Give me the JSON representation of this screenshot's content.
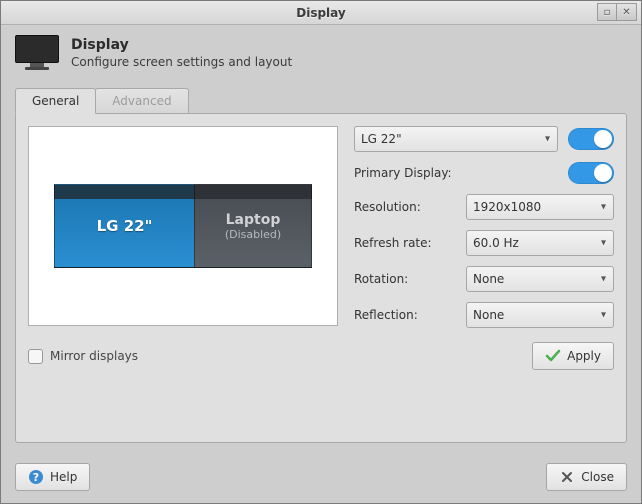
{
  "window": {
    "title": "Display"
  },
  "header": {
    "title": "Display",
    "subtitle": "Configure screen settings and layout"
  },
  "tabs": {
    "general": "General",
    "advanced": "Advanced"
  },
  "preview": {
    "primary": {
      "name": "LG 22\""
    },
    "secondary": {
      "name": "Laptop",
      "status": "(Disabled)"
    }
  },
  "settings": {
    "display_selected": "LG 22\"",
    "primary_label": "Primary Display:",
    "resolution_label": "Resolution:",
    "resolution_value": "1920x1080",
    "refresh_label": "Refresh rate:",
    "refresh_value": "60.0 Hz",
    "rotation_label": "Rotation:",
    "rotation_value": "None",
    "reflection_label": "Reflection:",
    "reflection_value": "None"
  },
  "mirror": {
    "label": "Mirror displays"
  },
  "buttons": {
    "apply": "Apply",
    "help": "Help",
    "close": "Close"
  }
}
